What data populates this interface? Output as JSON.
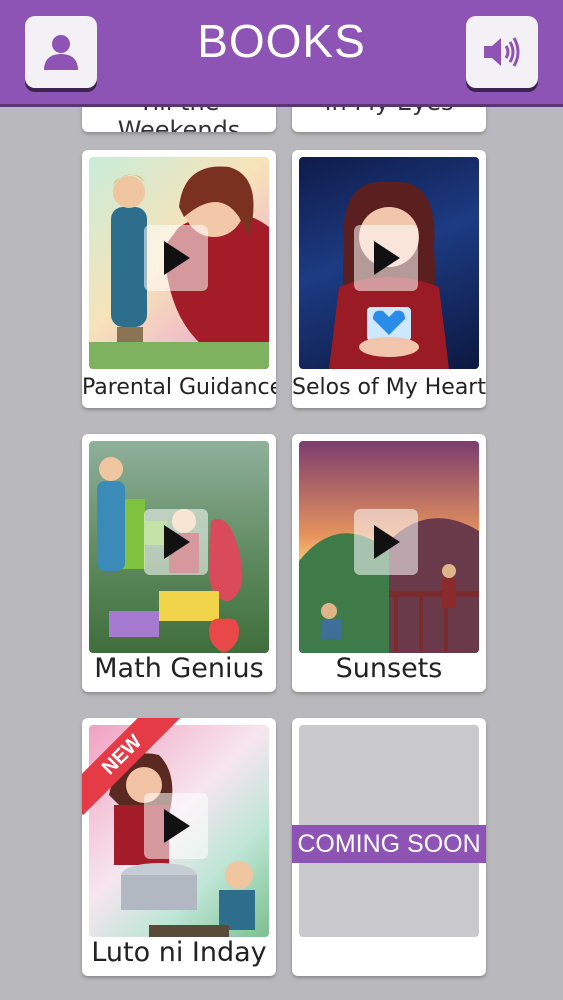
{
  "header": {
    "title": "BOOKS",
    "profile_icon": "user-icon",
    "sound_icon": "speaker-icon",
    "color": "#8e54b5"
  },
  "partial_books": [
    {
      "label": "Till the Weekends"
    },
    {
      "label": "In My Eyes"
    }
  ],
  "books": [
    {
      "label": "Parental Guidance",
      "play_icon": "play-icon"
    },
    {
      "label": "Selos of My Heart",
      "play_icon": "play-icon"
    },
    {
      "label": "Math Genius",
      "play_icon": "play-icon"
    },
    {
      "label": "Sunsets",
      "play_icon": "play-icon"
    },
    {
      "label": "Luto ni Inday",
      "badge": "NEW",
      "play_icon": "play-icon"
    },
    {
      "label": "",
      "banner": "COMING SOON"
    }
  ]
}
